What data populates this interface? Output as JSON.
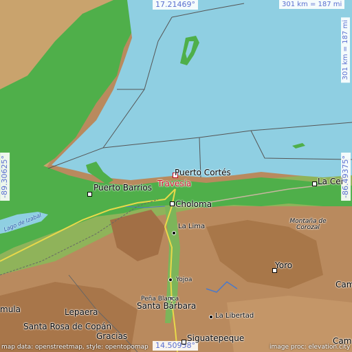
{
  "map": {
    "latitude_top": "17.21469°",
    "latitude_bottom": "14.50958°",
    "longitude_left": "-89.30625°",
    "longitude_right": "-86.49375°",
    "scale": "301 km = 187 mi",
    "scale_vertical": "301 km = 187 mi",
    "highlight": "Travesía",
    "colors": {
      "sea": "#8fcfe2",
      "lowland": "#4faf4a",
      "highland": "#b98a5e",
      "highlight": "#d0102a",
      "coord_text": "#5a6fd0"
    }
  },
  "places": {
    "puerto_cortes": "Puerto Cortés",
    "travesia": "Travesía",
    "puerto_barrios": "Puerto Barrios",
    "choloma": "Choloma",
    "la_lima": "La Lima",
    "la_ceiba": "La Cei",
    "montana_corozal": "Montaña de Corozal",
    "yoro": "Yoro",
    "yojoa": "Yojoa",
    "pena_blanca": "Peña Blanca",
    "santa_barbara": "Santa Bárbara",
    "la_libertad": "La Libertad",
    "lepaera": "Lepaera",
    "santa_rosa": "Santa Rosa de Copán",
    "gracias": "Gracias",
    "siguatepeque": "Siguatepeque",
    "gualala": "mula",
    "cam": "Cam",
    "cam2": "Cam",
    "lago_izabal": "Lago de Izabal"
  },
  "credits": {
    "left": "map data: openstreetmap, style: opentopomap",
    "right": "image proc: elevation.city"
  }
}
